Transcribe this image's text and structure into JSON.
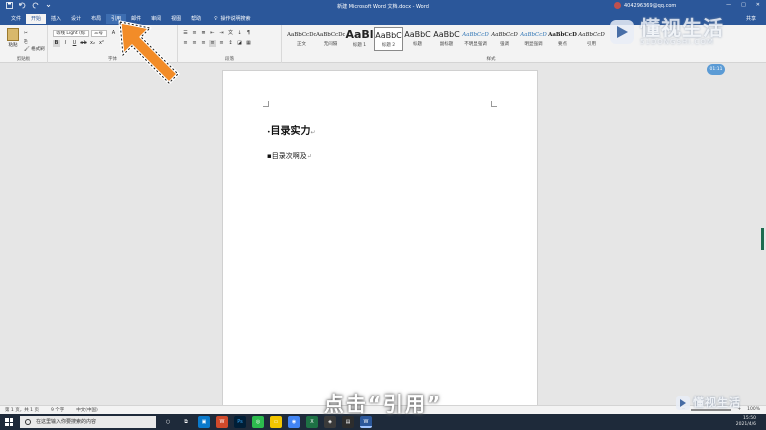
{
  "window": {
    "title": "新建 Microsoft Word 文档.docx - Word",
    "account": "404296369@qq.com"
  },
  "tabs": [
    {
      "label": "文件"
    },
    {
      "label": "开始"
    },
    {
      "label": "插入"
    },
    {
      "label": "设计"
    },
    {
      "label": "布局"
    },
    {
      "label": "引用"
    },
    {
      "label": "邮件"
    },
    {
      "label": "审阅"
    },
    {
      "label": "视图"
    },
    {
      "label": "帮助"
    }
  ],
  "tell_me": "操作说明搜索",
  "share": "共享",
  "ribbon": {
    "clipboard": {
      "paste": "粘贴",
      "format_painter": "格式刷",
      "group": "剪贴板"
    },
    "font": {
      "name": "等线 Light (标",
      "size": "三号",
      "group": "字体"
    },
    "paragraph": {
      "group": "段落"
    },
    "styles": {
      "group": "样式",
      "items": [
        {
          "preview": "AaBbCcDc",
          "name": "正文"
        },
        {
          "preview": "AaBbCcDc",
          "name": "无间隔"
        },
        {
          "preview": "AaBl",
          "name": "标题 1"
        },
        {
          "preview": "AaBbC",
          "name": "标题 2"
        },
        {
          "preview": "AaBbC",
          "name": "标题"
        },
        {
          "preview": "AaBbC",
          "name": "副标题"
        },
        {
          "preview": "AaBbCcD",
          "name": "不明显强调"
        },
        {
          "preview": "AaBbCcD",
          "name": "强调"
        },
        {
          "preview": "AaBbCcD",
          "name": "明显强调"
        },
        {
          "preview": "AaBbCcD",
          "name": "要点"
        },
        {
          "preview": "AaBbCcD",
          "name": "引用"
        }
      ]
    }
  },
  "timer": "01:11",
  "document": {
    "line1": "目录实力",
    "line2": "目录次啊及",
    "para_mark": "↵"
  },
  "status": {
    "page": "第 1 页，共 1 页",
    "words": "9 个字",
    "lang": "中文(中国)",
    "zoom": "100%"
  },
  "taskbar": {
    "search_placeholder": "在这里输入你要搜索的内容",
    "time": "15:50",
    "date": "2021/4/6"
  },
  "overlay": {
    "caption": "点击“引用”",
    "watermark": "懂视生活",
    "watermark_sub": "51DONGSHI.COM"
  },
  "colors": {
    "word_blue": "#2b579a",
    "arrow_orange": "#f28c28"
  }
}
